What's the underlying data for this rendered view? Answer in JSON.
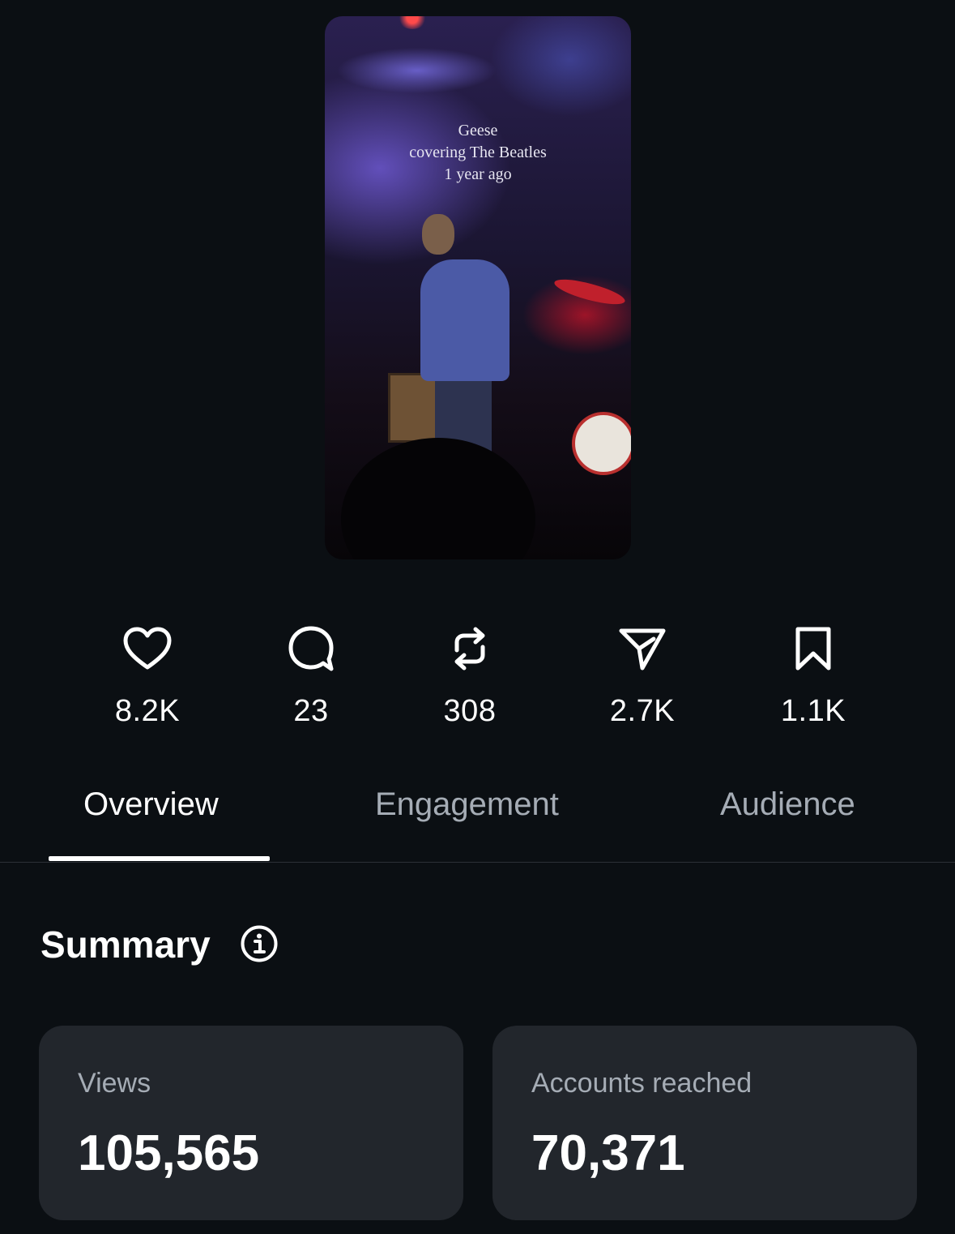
{
  "video": {
    "caption_lines": [
      "Geese",
      "covering The Beatles",
      "1 year ago"
    ]
  },
  "stats": [
    {
      "icon": "heart-icon",
      "value": "8.2K"
    },
    {
      "icon": "comment-icon",
      "value": "23"
    },
    {
      "icon": "repost-icon",
      "value": "308"
    },
    {
      "icon": "share-icon",
      "value": "2.7K"
    },
    {
      "icon": "bookmark-icon",
      "value": "1.1K"
    }
  ],
  "tabs": [
    {
      "label": "Overview",
      "active": true
    },
    {
      "label": "Engagement",
      "active": false
    },
    {
      "label": "Audience",
      "active": false
    }
  ],
  "summary": {
    "title": "Summary",
    "info_icon": "info-icon",
    "cards": [
      {
        "label": "Views",
        "value": "105,565"
      },
      {
        "label": "Accounts reached",
        "value": "70,371"
      }
    ]
  },
  "colors": {
    "background": "#0b0f13",
    "card": "#22262c",
    "muted_text": "#a5acb5",
    "text": "#ffffff"
  }
}
